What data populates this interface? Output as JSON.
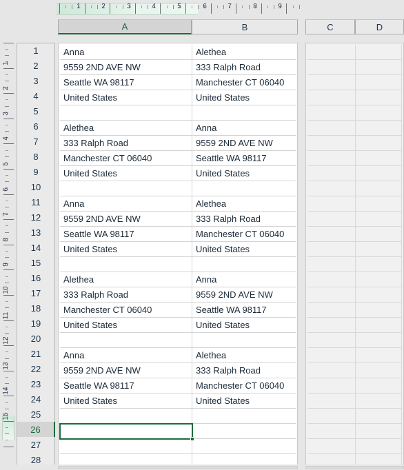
{
  "app": {
    "view_name": "Page Layout",
    "select_all_corner": "select-all-triangle"
  },
  "rulers": {
    "horizontal": {
      "unit": "inches",
      "labels": [
        "1",
        "2",
        "3",
        "4",
        "5",
        "6",
        "7",
        "8",
        "9"
      ],
      "page_width_in": 5.5,
      "highlight_color": "#cfe8d8"
    },
    "vertical": {
      "unit": "inches",
      "labels": [
        "1",
        "2",
        "3",
        "4",
        "5",
        "6",
        "7",
        "8",
        "9",
        "10",
        "11",
        "12",
        "13",
        "14",
        "15"
      ],
      "highlight_color": "#a8d8bc"
    }
  },
  "columns": [
    {
      "label": "A",
      "selected": true
    },
    {
      "label": "B",
      "selected": false
    },
    {
      "label": "C",
      "selected": false
    },
    {
      "label": "D",
      "selected": false
    }
  ],
  "rows": [
    {
      "label": "1",
      "selected": false
    },
    {
      "label": "2",
      "selected": false
    },
    {
      "label": "3",
      "selected": false
    },
    {
      "label": "4",
      "selected": false
    },
    {
      "label": "5",
      "selected": false
    },
    {
      "label": "6",
      "selected": false
    },
    {
      "label": "7",
      "selected": false
    },
    {
      "label": "8",
      "selected": false
    },
    {
      "label": "9",
      "selected": false
    },
    {
      "label": "10",
      "selected": false
    },
    {
      "label": "11",
      "selected": false
    },
    {
      "label": "12",
      "selected": false
    },
    {
      "label": "13",
      "selected": false
    },
    {
      "label": "14",
      "selected": false
    },
    {
      "label": "15",
      "selected": false
    },
    {
      "label": "16",
      "selected": false
    },
    {
      "label": "17",
      "selected": false
    },
    {
      "label": "18",
      "selected": false
    },
    {
      "label": "19",
      "selected": false
    },
    {
      "label": "20",
      "selected": false
    },
    {
      "label": "21",
      "selected": false
    },
    {
      "label": "22",
      "selected": false
    },
    {
      "label": "23",
      "selected": false
    },
    {
      "label": "24",
      "selected": false
    },
    {
      "label": "25",
      "selected": false
    },
    {
      "label": "26",
      "selected": true
    },
    {
      "label": "27",
      "selected": false
    },
    {
      "label": "28",
      "selected": false
    }
  ],
  "cells": {
    "A": [
      "Anna",
      "9559 2ND AVE NW",
      "Seattle WA 98117",
      "United States",
      "",
      "Alethea",
      "333 Ralph Road",
      "Manchester CT 06040",
      "United States",
      "",
      "Anna",
      "9559 2ND AVE NW",
      "Seattle WA 98117",
      "United States",
      "",
      "Alethea",
      "333 Ralph Road",
      "Manchester CT 06040",
      "United States",
      "",
      "Anna",
      "9559 2ND AVE NW",
      "Seattle WA 98117",
      "United States",
      "",
      "",
      "",
      ""
    ],
    "B": [
      "Alethea",
      "333 Ralph Road",
      "Manchester CT 06040",
      "United States",
      "",
      "Anna",
      "9559 2ND AVE NW",
      "Seattle WA 98117",
      "United States",
      "",
      "Alethea",
      "333 Ralph Road",
      "Manchester CT 06040",
      "United States",
      "",
      "Anna",
      "9559 2ND AVE NW",
      "Seattle WA 98117",
      "United States",
      "",
      "Alethea",
      "333 Ralph Road",
      "Manchester CT 06040",
      "United States",
      "",
      "",
      "",
      ""
    ],
    "C": [
      "",
      "",
      "",
      "",
      "",
      "",
      "",
      "",
      "",
      "",
      "",
      "",
      "",
      "",
      "",
      "",
      "",
      "",
      "",
      "",
      "",
      "",
      "",
      "",
      "",
      "",
      "",
      ""
    ],
    "D": [
      "",
      "",
      "",
      "",
      "",
      "",
      "",
      "",
      "",
      "",
      "",
      "",
      "",
      "",
      "",
      "",
      "",
      "",
      "",
      "",
      "",
      "",
      "",
      "",
      "",
      "",
      "",
      ""
    ]
  },
  "selection": {
    "active_cell": "A26",
    "row_index": 26,
    "column": "A",
    "border_color": "#1d6b3e",
    "fill_handle": "fill-handle"
  },
  "scrollbars": {
    "horizontal_primary": "h-scrollbar-main",
    "horizontal_secondary": "h-scrollbar-side"
  }
}
